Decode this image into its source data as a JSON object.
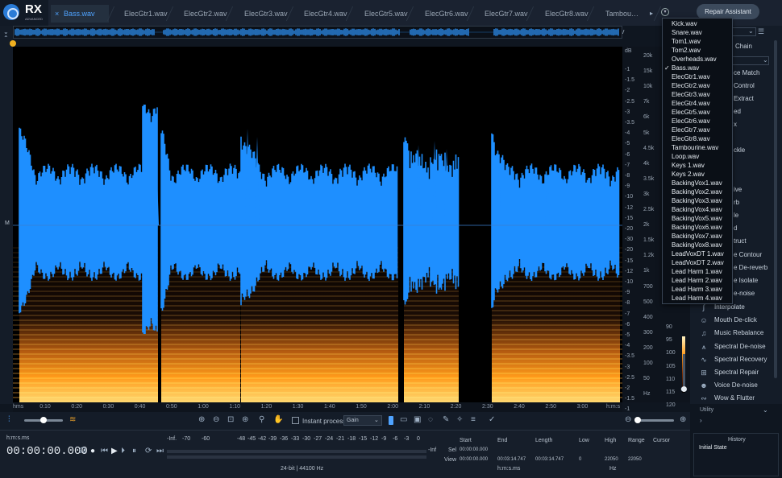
{
  "app": {
    "name": "RX",
    "edition": "ADVANCED"
  },
  "tabs": [
    {
      "label": "Bass.wav",
      "active": true
    },
    {
      "label": "ElecGtr1.wav"
    },
    {
      "label": "ElecGtr2.wav"
    },
    {
      "label": "ElecGtr3.wav"
    },
    {
      "label": "ElecGtr4.wav"
    },
    {
      "label": "ElecGtr5.wav"
    },
    {
      "label": "ElecGtr6.wav"
    },
    {
      "label": "ElecGtr7.wav"
    },
    {
      "label": "ElecGtr8.wav"
    },
    {
      "label": "Tambou…e.wav"
    }
  ],
  "repair_assistant": "Repair Assistant",
  "file_dropdown": {
    "selected": "Bass.wav",
    "items": [
      "Kick.wav",
      "Snare.wav",
      "Tom1.wav",
      "Tom2.wav",
      "Overheads.wav",
      "Bass.wav",
      "ElecGtr1.wav",
      "ElecGtr2.wav",
      "ElecGtr3.wav",
      "ElecGtr4.wav",
      "ElecGtr5.wav",
      "ElecGtr6.wav",
      "ElecGtr7.wav",
      "ElecGtr8.wav",
      "Tambourine.wav",
      "Loop.wav",
      "Keys 1.wav",
      "Keys 2.wav",
      "BackingVox1.wav",
      "BackingVox2.wav",
      "BackingVox3.wav",
      "BackingVox4.wav",
      "BackingVox5.wav",
      "BackingVox6.wav",
      "BackingVox7.wav",
      "BackingVox8.wav",
      "LeadVoxDT 1.wav",
      "LeadVoxDT 2.wav",
      "Lead Harm 1.wav",
      "Lead Harm 2.wav",
      "Lead Harm 3.wav",
      "Lead Harm 4.wav"
    ]
  },
  "modules_partial": [
    "Chain",
    "ce Match",
    "Control",
    "Extract",
    "ed",
    "x",
    "ckle",
    "ive",
    "rb",
    "le",
    "d",
    "truct",
    "e Contour",
    "e De-reverb",
    "e Isolate",
    "e-noise"
  ],
  "modules": [
    "Interpolate",
    "Mouth De-click",
    "Music Rebalance",
    "Spectral De-noise",
    "Spectral Recovery",
    "Spectral Repair",
    "Voice De-noise",
    "Wow & Flutter"
  ],
  "utility_label": "Utility",
  "waveform_channel_label": "M",
  "db_label": "dB",
  "db_ticks": [
    "-1",
    "-1.5",
    "-2",
    "-2.5",
    "-3",
    "-3.5",
    "-4",
    "-5",
    "-6",
    "-7",
    "-8",
    "-9",
    "-10",
    "-12",
    "-15",
    "-20",
    "-30",
    "-20",
    "-15",
    "-12",
    "-10",
    "-9",
    "-8",
    "-7",
    "-6",
    "-5",
    "-4",
    "-3.5",
    "-3",
    "-2.5",
    "-2",
    "-1.5",
    "-1"
  ],
  "freq_ticks": [
    "20k",
    "15k",
    "10k",
    "7k",
    "6k",
    "5k",
    "4.5k",
    "4k",
    "3.5k",
    "3k",
    "2.5k",
    "2k",
    "1.5k",
    "1.2k",
    "1k",
    "700",
    "500",
    "400",
    "300",
    "200",
    "100",
    "50",
    "Hz"
  ],
  "spec_db_ticks": [
    "-15",
    "-20",
    "-25",
    "-30",
    "-35",
    "-40",
    "-45",
    "-50",
    "-55",
    "-60",
    "-65",
    "-70",
    "-75",
    "-80",
    "-85",
    "-90",
    "-95",
    "-100",
    "-105",
    "-110",
    "-115",
    "-120"
  ],
  "spec_db_visible": [
    "90",
    "95",
    "100",
    "105",
    "110",
    "115",
    "120"
  ],
  "time_ticks": [
    "hms",
    "0:10",
    "0:20",
    "0:30",
    "0:40",
    "0:50",
    "1:00",
    "1:10",
    "1:20",
    "1:30",
    "1:40",
    "1:50",
    "2:00",
    "2:10",
    "2:20",
    "2:30",
    "2:40",
    "2:50",
    "3:00",
    "h:m:s"
  ],
  "toolbar": {
    "instant_process": "Instant process",
    "gain": "Gain"
  },
  "transport": {
    "format": "h:m:s.ms",
    "time": "00:00:00.000"
  },
  "meter": {
    "labels": [
      "-Inf.",
      "-70",
      "-60",
      "-48",
      "-45",
      "-42",
      "-39",
      "-36",
      "-33",
      "-30",
      "-27",
      "-24",
      "-21",
      "-18",
      "-15",
      "-12",
      "-9",
      "-6",
      "-3",
      "0"
    ],
    "inf_right": "-Inf",
    "format": "24-bit | 44100 Hz"
  },
  "selection": {
    "headers": [
      "Start",
      "End",
      "Length"
    ],
    "sel_label": "Sel",
    "view_label": "View",
    "sel": [
      "00:00:00.000"
    ],
    "view": [
      "00:00:00.000",
      "00:03:14.747",
      "00:03:14.747"
    ],
    "end": "00:03:14.747",
    "unit": "h:m:s.ms"
  },
  "freq_range": {
    "headers": [
      "Low",
      "High",
      "Range"
    ],
    "values": [
      "0",
      "22050",
      "22050"
    ],
    "unit": "Hz"
  },
  "cursor_label": "Cursor",
  "history": {
    "title": "History",
    "items": [
      "Initial State"
    ]
  },
  "colors": {
    "accent": "#4fa3ff",
    "waveform": "#1e8fff",
    "spectro_hot": "#ff9a1a"
  }
}
